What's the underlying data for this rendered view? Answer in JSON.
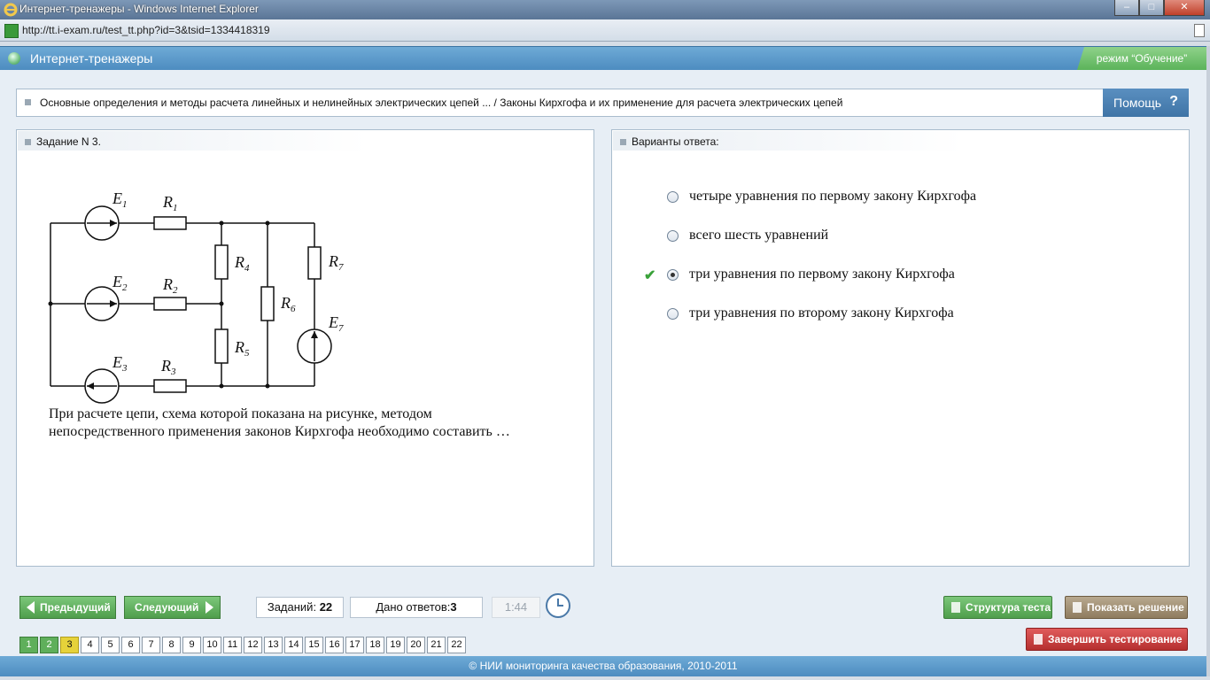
{
  "window": {
    "title": "Интернет-тренажеры - Windows Internet Explorer"
  },
  "address": {
    "url": "http://tt.i-exam.ru/test_tt.php?id=3&tsid=1334418319"
  },
  "header": {
    "title": "Интернет-тренажеры",
    "mode": "режим “Обучение”"
  },
  "breadcrumb": {
    "text": "Основные определения и методы расчета линейных и нелинейных электрических цепей ... / Законы Кирхгофа и их применение для расчета электрических цепей"
  },
  "help": {
    "label": "Помощь",
    "icon": "?"
  },
  "task": {
    "heading": "Задание N 3.",
    "question": "При расчете цепи, схема которой показана на рисунке, методом непосредственного применения законов Кирхгофа необходимо составить …",
    "circuit_labels": {
      "e1": "E",
      "e1_sub": "1",
      "e2": "E",
      "e2_sub": "2",
      "e3": "E",
      "e3_sub": "3",
      "e7": "E",
      "e7_sub": "7",
      "r1": "R",
      "r1_sub": "1",
      "r2": "R",
      "r2_sub": "2",
      "r3": "R",
      "r3_sub": "3",
      "r4": "R",
      "r4_sub": "4",
      "r5": "R",
      "r5_sub": "5",
      "r6": "R",
      "r6_sub": "6",
      "r7": "R",
      "r7_sub": "7"
    }
  },
  "answers": {
    "heading": "Варианты ответа:",
    "options": [
      {
        "text": "четыре уравнения по первому закону Кирхгофа",
        "selected": false
      },
      {
        "text": "всего шесть уравнений",
        "selected": false
      },
      {
        "text": "три уравнения по первому закону Кирхгофа",
        "selected": true
      },
      {
        "text": "три уравнения по второму закону Кирхгофа",
        "selected": false
      }
    ],
    "correct_icon": "checkmark-icon",
    "correct_mark": "✔"
  },
  "nav": {
    "prev": "Предыдущий",
    "next": "Следующий",
    "tasks_label": "Заданий:",
    "tasks_count": "22",
    "answered_label": "Дано ответов:",
    "answered_count": "3",
    "timer": "1:44",
    "structure": "Структура теста",
    "show_solution": "Показать решение",
    "finish": "Завершить тестирование",
    "pages": [
      "1",
      "2",
      "3",
      "4",
      "5",
      "6",
      "7",
      "8",
      "9",
      "10",
      "11",
      "12",
      "13",
      "14",
      "15",
      "16",
      "17",
      "18",
      "19",
      "20",
      "21",
      "22"
    ],
    "pages_done": [
      "1",
      "2"
    ],
    "page_current": "3"
  },
  "footer": {
    "text": "© НИИ мониторинга качества образования, 2010-2011"
  },
  "colors": {
    "accent": "#4d8cc0",
    "success": "#5faf5b",
    "current_page": "#e6d23a",
    "danger": "#b52f2f"
  }
}
